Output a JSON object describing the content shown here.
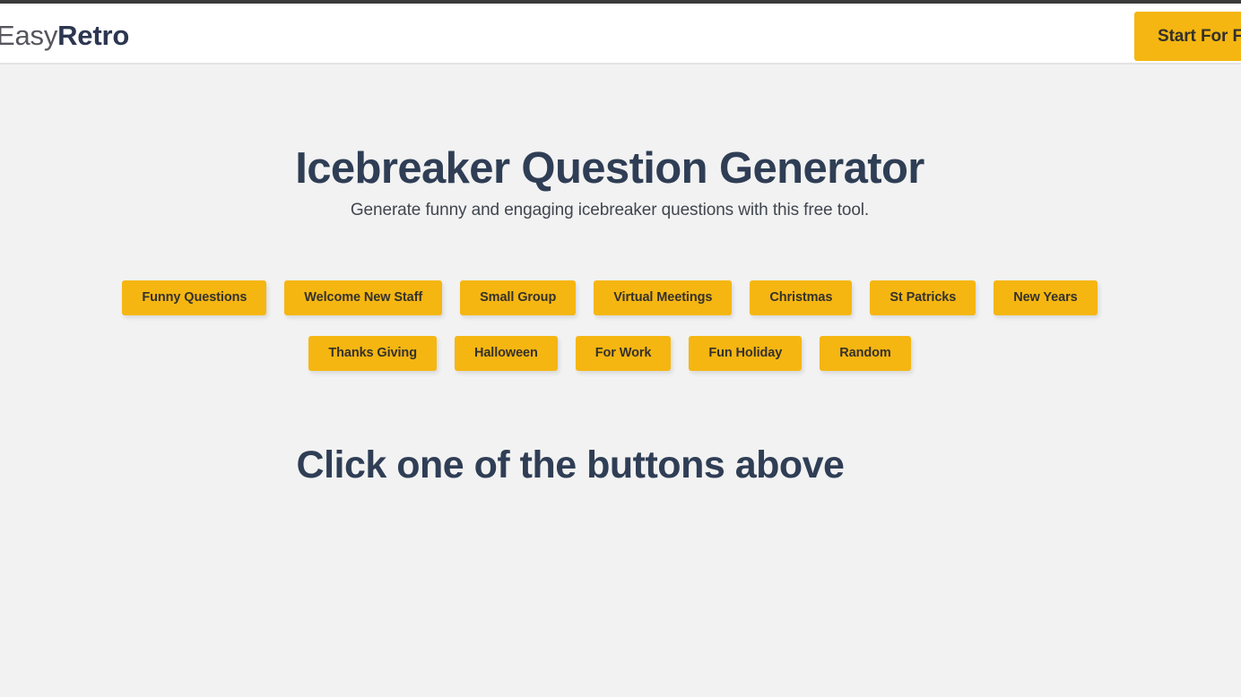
{
  "header": {
    "brand_first": "Easy",
    "brand_second": "Retro",
    "cta_label": "Start For Free"
  },
  "main": {
    "title": "Icebreaker Question Generator",
    "subtitle": "Generate funny and engaging icebreaker questions with this free tool.",
    "result_placeholder": "Click one of the buttons above",
    "category_rows": [
      [
        {
          "label": "Funny Questions"
        },
        {
          "label": "Welcome New Staff"
        },
        {
          "label": "Small Group"
        },
        {
          "label": "Virtual Meetings"
        },
        {
          "label": "Christmas"
        },
        {
          "label": "St Patricks"
        },
        {
          "label": "New Years"
        }
      ],
      [
        {
          "label": "Thanks Giving"
        },
        {
          "label": "Halloween"
        },
        {
          "label": "For Work"
        },
        {
          "label": "Fun Holiday"
        },
        {
          "label": "Random"
        }
      ]
    ]
  },
  "theme": {
    "accent": "#f5b612",
    "heading": "#2f3e55",
    "page_background": "#f2f2f2",
    "header_background": "#ffffff",
    "top_strip": "#3a3a3a",
    "button_text": "#35322c"
  }
}
